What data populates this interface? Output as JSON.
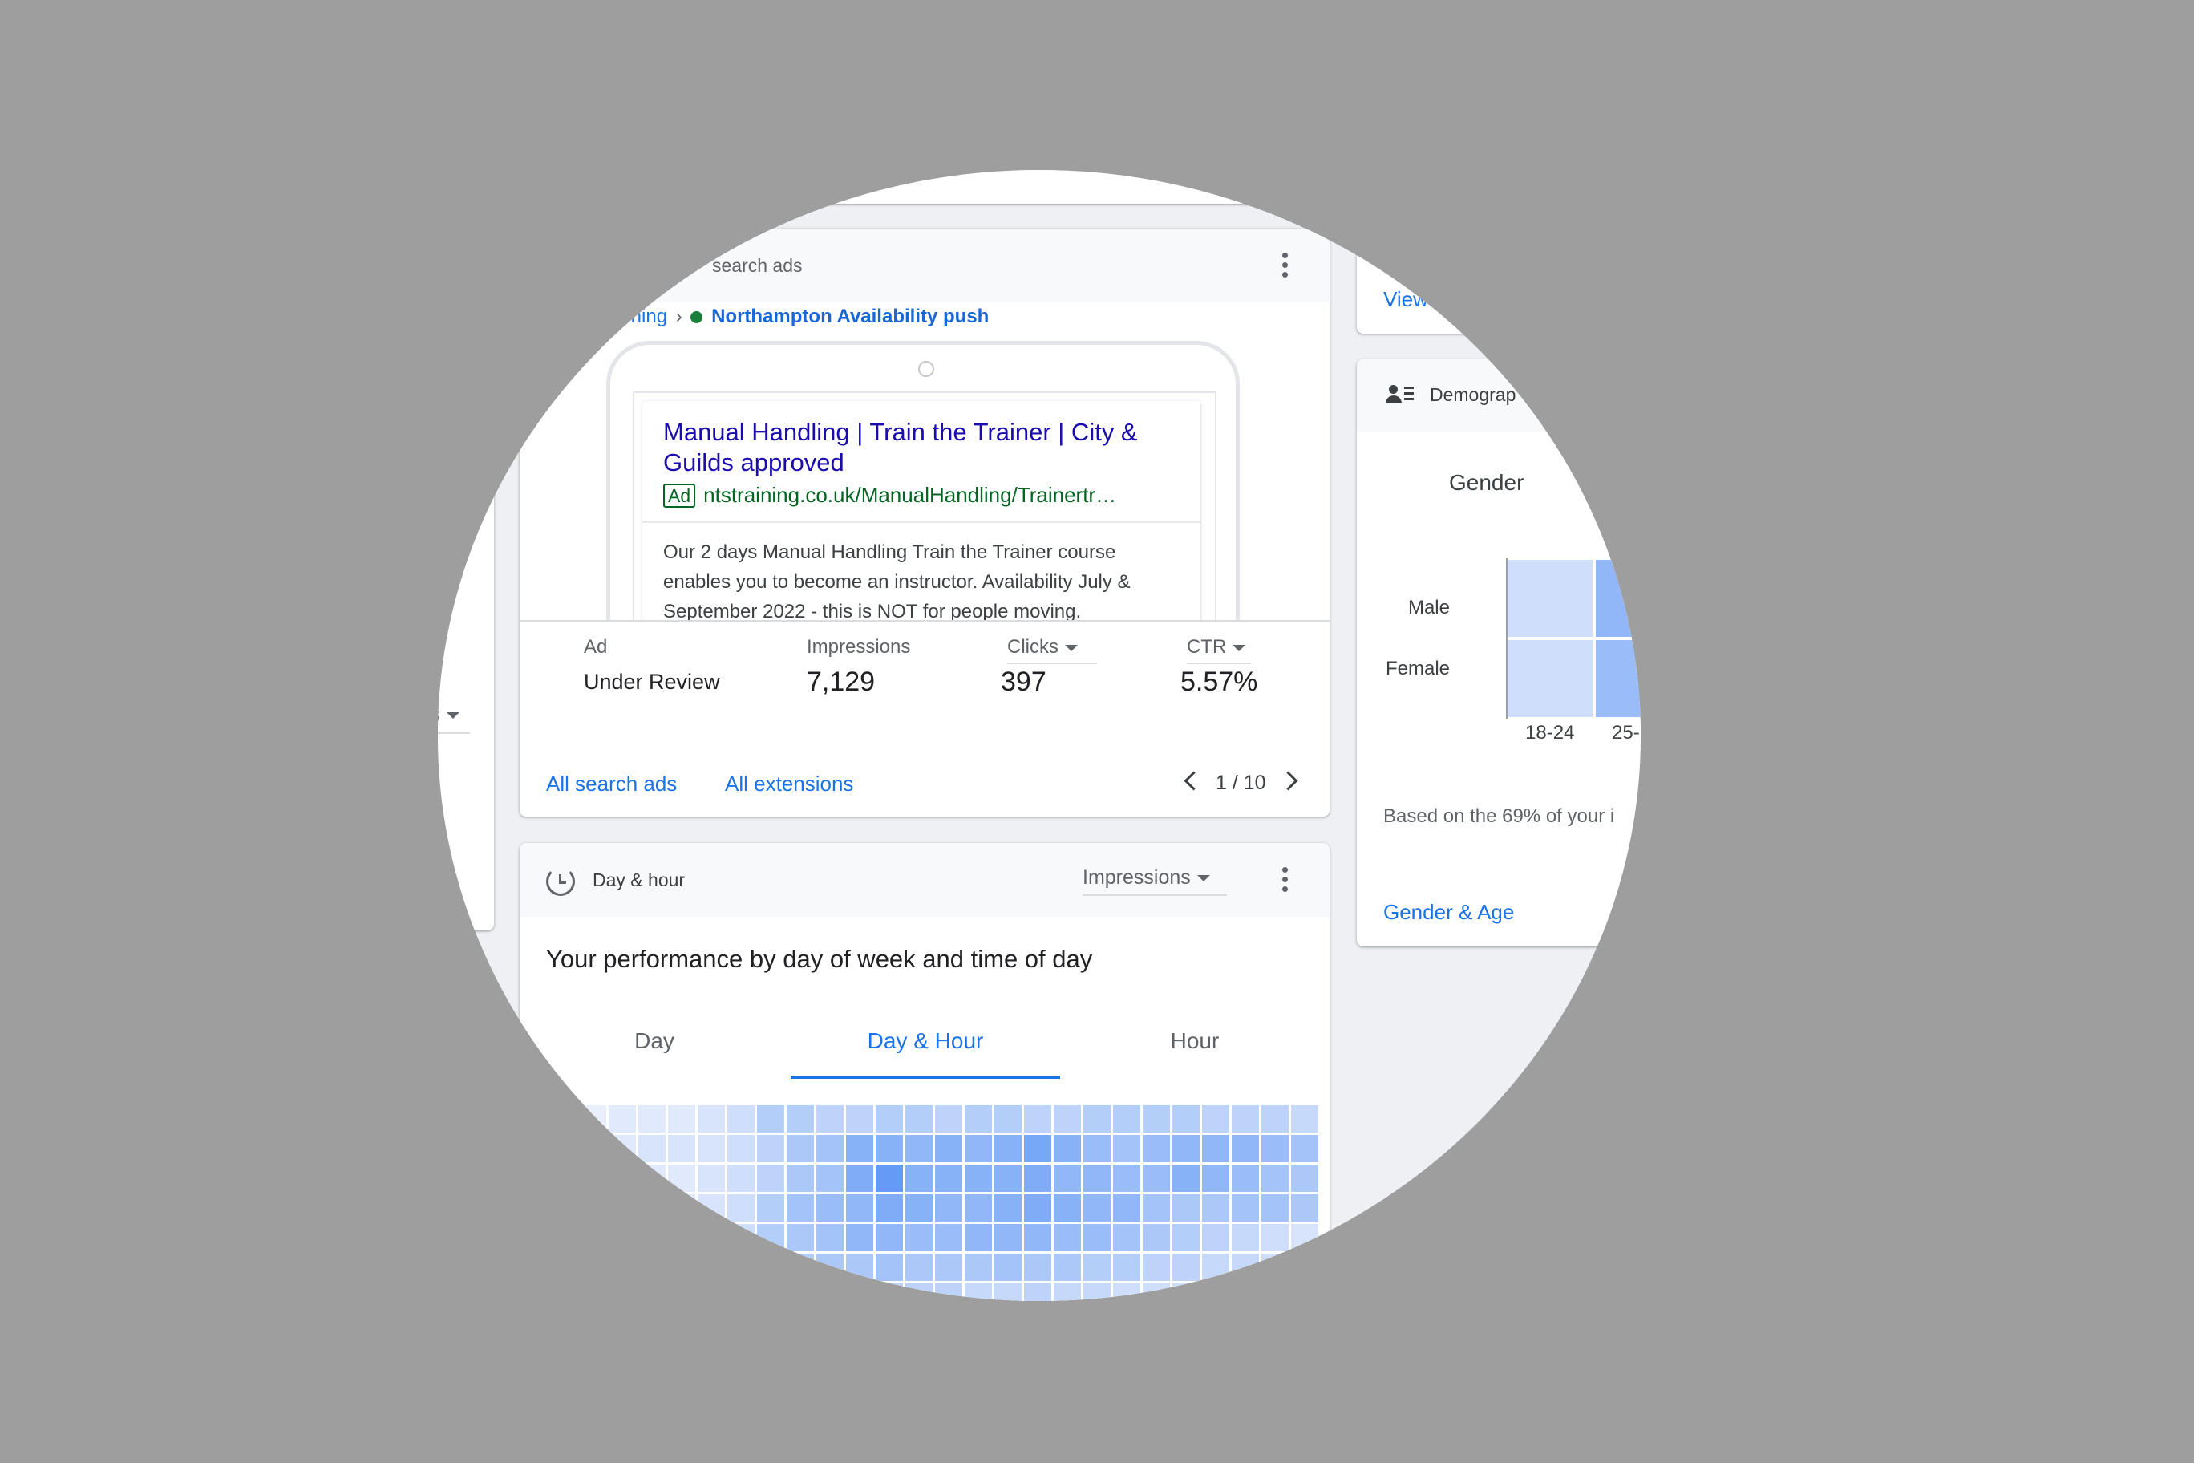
{
  "search_ads_card": {
    "title": "search ads",
    "breadcrumb_campaign": "aining",
    "breadcrumb_separator": "›",
    "breadcrumb_adgroup": "Northampton Availability push",
    "status_color": "#188038",
    "ad_preview": {
      "headline": "Manual Handling | Train the Trainer | City & Guilds approved",
      "badge": "Ad",
      "url": "ntstraining.co.uk/ManualHandling/Trainertr…",
      "description": "Our 2 days Manual Handling Train the Trainer course enables you to become an instructor. Availability July & September 2022 - this is NOT for people moving."
    },
    "stats": {
      "ad_label": "Ad",
      "ad_status": "Under Review",
      "impressions_label": "Impressions",
      "impressions_value": "7,129",
      "clicks_label": "Clicks",
      "clicks_value": "397",
      "ctr_label": "CTR",
      "ctr_value": "5.57%"
    },
    "links": {
      "all_search_ads": "All search ads",
      "all_extensions": "All extensions"
    },
    "pagination": "1 / 10"
  },
  "day_hour_card": {
    "title": "Day & hour",
    "metric_select": "Impressions",
    "subtitle": "Your performance by day of week and time of day",
    "tabs": [
      "Day",
      "Day & Hour",
      "Hour"
    ],
    "active_tab": 1,
    "heatmap": [
      [
        0.05,
        0.1,
        0.1,
        0.1,
        0.15,
        0.2,
        0.35,
        0.35,
        0.3,
        0.3,
        0.35,
        0.35,
        0.3,
        0.35,
        0.35,
        0.3,
        0.3,
        0.35,
        0.35,
        0.35,
        0.35,
        0.3,
        0.3,
        0.3,
        0.25
      ],
      [
        0.05,
        0.1,
        0.15,
        0.15,
        0.15,
        0.2,
        0.3,
        0.4,
        0.45,
        0.6,
        0.6,
        0.55,
        0.6,
        0.55,
        0.6,
        0.7,
        0.6,
        0.5,
        0.45,
        0.5,
        0.55,
        0.55,
        0.55,
        0.5,
        0.45
      ],
      [
        0.05,
        0.1,
        0.1,
        0.1,
        0.15,
        0.2,
        0.3,
        0.4,
        0.45,
        0.65,
        0.8,
        0.6,
        0.6,
        0.6,
        0.6,
        0.65,
        0.55,
        0.55,
        0.5,
        0.5,
        0.6,
        0.55,
        0.5,
        0.45,
        0.4
      ],
      [
        0.05,
        0.1,
        0.1,
        0.1,
        0.15,
        0.2,
        0.35,
        0.45,
        0.5,
        0.55,
        0.65,
        0.6,
        0.55,
        0.55,
        0.6,
        0.65,
        0.6,
        0.55,
        0.55,
        0.45,
        0.4,
        0.4,
        0.45,
        0.45,
        0.4
      ],
      [
        0.05,
        0.1,
        0.1,
        0.1,
        0.15,
        0.2,
        0.35,
        0.4,
        0.45,
        0.55,
        0.55,
        0.5,
        0.5,
        0.55,
        0.55,
        0.55,
        0.5,
        0.5,
        0.45,
        0.4,
        0.35,
        0.3,
        0.25,
        0.2,
        0.15
      ],
      [
        0.05,
        0.1,
        0.1,
        0.1,
        0.15,
        0.2,
        0.3,
        0.35,
        0.4,
        0.4,
        0.45,
        0.4,
        0.4,
        0.4,
        0.45,
        0.4,
        0.4,
        0.35,
        0.35,
        0.3,
        0.3,
        0.25,
        0.25,
        0.2,
        0.15
      ],
      [
        0.05,
        0.05,
        0.1,
        0.1,
        0.1,
        0.15,
        0.2,
        0.25,
        0.25,
        0.3,
        0.3,
        0.3,
        0.3,
        0.25,
        0.25,
        0.3,
        0.25,
        0.25,
        0.2,
        0.2,
        0.2,
        0.15,
        0.15,
        0.15,
        0.1
      ]
    ],
    "heatmap_base_color": "#4285f4"
  },
  "views_card": {
    "link": "View"
  },
  "demographics_card": {
    "title": "Demograp",
    "gender_title": "Gender",
    "rows": [
      "Male",
      "Female"
    ],
    "columns": [
      "18-24",
      "25-"
    ],
    "values": [
      [
        0.2,
        0.55
      ],
      [
        0.2,
        0.5
      ]
    ],
    "note": "Based on the 69% of your i",
    "link": "Gender & Age"
  },
  "left_card": {
    "select_fragment": "s"
  }
}
